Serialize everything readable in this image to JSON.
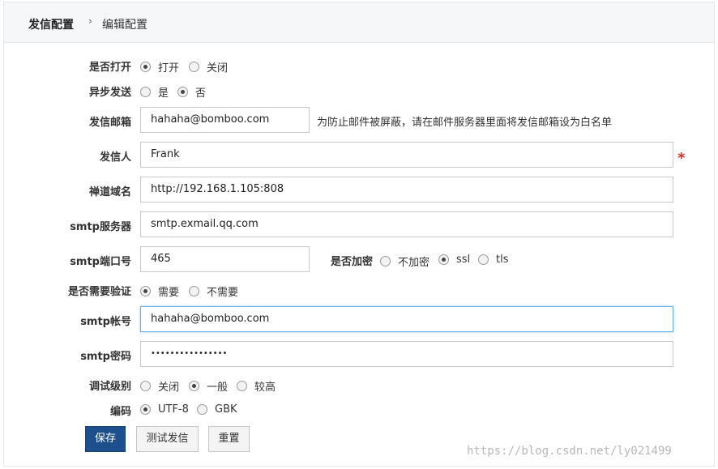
{
  "breadcrumb": {
    "root": "发信配置",
    "separator": "›",
    "current": "编辑配置"
  },
  "form": {
    "enabled": {
      "label": "是否打开",
      "options": [
        "打开",
        "关闭"
      ],
      "selected": "打开"
    },
    "async": {
      "label": "异步发送",
      "options": [
        "是",
        "否"
      ],
      "selected": "否"
    },
    "sender_email": {
      "label": "发信邮箱",
      "value": "hahaha@bomboo.com",
      "hint": "为防止邮件被屏蔽，请在邮件服务器里面将发信邮箱设为白名单"
    },
    "sender_name": {
      "label": "发信人",
      "value": "Frank",
      "required_mark": "*"
    },
    "domain": {
      "label": "禅道域名",
      "value": "http://192.168.1.105:808"
    },
    "smtp_server": {
      "label": "smtp服务器",
      "value": "smtp.exmail.qq.com"
    },
    "smtp_port": {
      "label": "smtp端口号",
      "value": "465"
    },
    "encryption": {
      "label": "是否加密",
      "options": [
        "不加密",
        "ssl",
        "tls"
      ],
      "selected": "ssl"
    },
    "auth": {
      "label": "是否需要验证",
      "options": [
        "需要",
        "不需要"
      ],
      "selected": "需要"
    },
    "smtp_account": {
      "label": "smtp帐号",
      "value": "hahaha@bomboo.com"
    },
    "smtp_password": {
      "label": "smtp密码",
      "value": "••••••••••••••••"
    },
    "debug": {
      "label": "调试级别",
      "options": [
        "关闭",
        "一般",
        "较高"
      ],
      "selected": "一般"
    },
    "charset": {
      "label": "编码",
      "options": [
        "UTF-8",
        "GBK"
      ],
      "selected": "UTF-8"
    }
  },
  "buttons": {
    "save": "保存",
    "test": "测试发信",
    "reset": "重置"
  },
  "watermark": "https://blog.csdn.net/ly021499",
  "colors": {
    "primary_button": "#1c4f8c",
    "required": "#d9312b",
    "focus_border": "#66afe9"
  }
}
